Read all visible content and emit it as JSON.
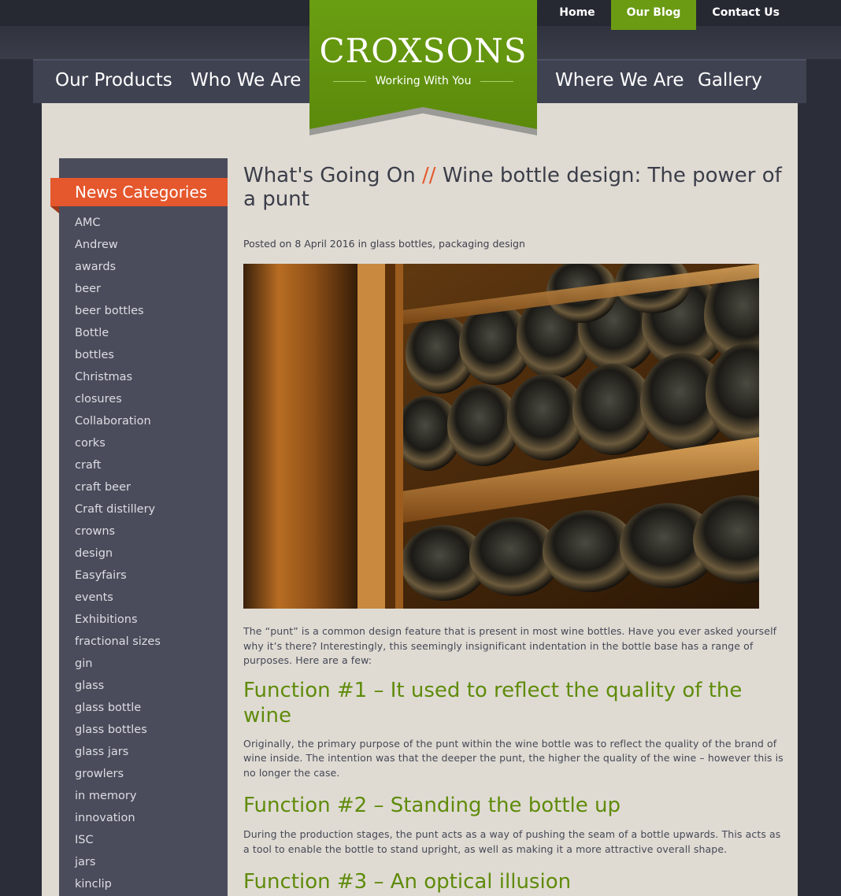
{
  "top_links": [
    {
      "label": "Home",
      "active": false
    },
    {
      "label": "Our Blog",
      "active": true
    },
    {
      "label": "Contact Us",
      "active": false
    }
  ],
  "brand": {
    "name": "CROXSONS",
    "tagline": "Working With You",
    "accent": "#6b9b13"
  },
  "main_nav": [
    "Our Products",
    "Who We Are",
    "Where We Are",
    "Gallery"
  ],
  "sidebar": {
    "heading": "News Categories",
    "heading_color": "#e5572c",
    "categories": [
      "AMC",
      "Andrew",
      "awards",
      "beer",
      "beer bottles",
      "Bottle",
      "bottles",
      "Christmas",
      "closures",
      "Collaboration",
      "corks",
      "craft",
      "craft beer",
      "Craft distillery",
      "crowns",
      "design",
      "Easyfairs",
      "events",
      "Exhibitions",
      "fractional sizes",
      "gin",
      "glass",
      "glass bottle",
      "glass bottles",
      "glass jars",
      "growlers",
      "in memory",
      "innovation",
      "ISC",
      "jars",
      "kinclip"
    ]
  },
  "article": {
    "section": "What's Going On",
    "separator": "//",
    "title": "Wine bottle design: The power of a punt",
    "meta_prefix": "Posted on",
    "date": "8 April 2016",
    "meta_in": "in",
    "categories": "glass bottles, packaging design",
    "intro": "The “punt” is a common design feature that is present in most wine bottles. Have you ever asked yourself why it’s there? Interestingly, this seemingly insignificant indentation in the bottle base has a range of purposes. Here are a few:",
    "sections": [
      {
        "heading": "Function #1 – It used to reflect the quality of the wine",
        "body": "Originally, the primary purpose of the punt within the wine bottle was to reflect the quality of the brand of wine inside. The intention was that the deeper the punt, the higher the quality of the wine – however this is no longer the case."
      },
      {
        "heading": "Function #2 – Standing the bottle up",
        "body": "During the production stages, the punt acts as a way of pushing the seam of a bottle upwards. This acts as a tool to enable the bottle to stand upright, as well as making it a more attractive overall shape."
      },
      {
        "heading": "Function #3 – An optical illusion",
        "body": ""
      }
    ]
  }
}
